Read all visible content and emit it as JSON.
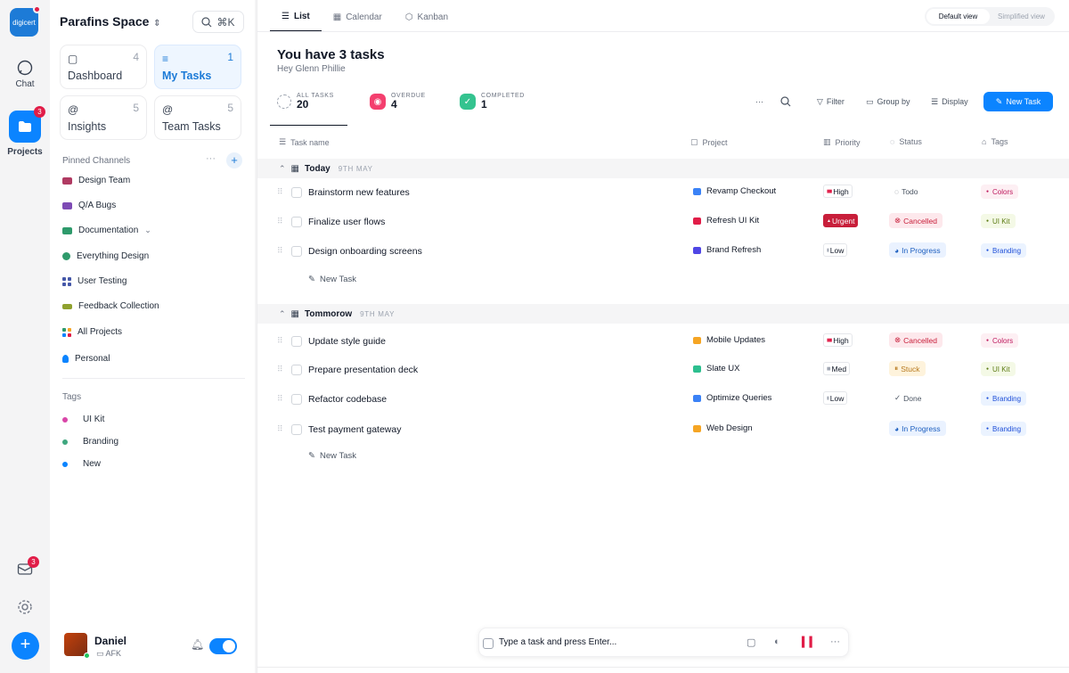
{
  "rail": {
    "logo_text": "digicert",
    "chat_label": "Chat",
    "projects_label": "Projects",
    "projects_badge": "3",
    "inbox_badge": "3"
  },
  "sidebar": {
    "space_name": "Parafins Space",
    "search_shortcut": "⌘K",
    "cards": [
      {
        "label": "Dashboard",
        "count": "4",
        "icon": "chat-icon"
      },
      {
        "label": "My Tasks",
        "count": "1",
        "icon": "filter-icon"
      },
      {
        "label": "Insights",
        "count": "5",
        "icon": "at-icon"
      },
      {
        "label": "Team Tasks",
        "count": "5",
        "icon": "at-icon"
      }
    ],
    "pinned_label": "Pinned Channels",
    "channels": [
      {
        "label": "Design Team",
        "color": "#b03a62"
      },
      {
        "label": "Q/A Bugs",
        "color": "#7e4bb5"
      },
      {
        "label": "Documentation",
        "color": "#2e9a6b"
      },
      {
        "label": "Everything Design",
        "color": "#2e9a6b"
      },
      {
        "label": "User Testing",
        "color": "#4457a8"
      },
      {
        "label": "Feedback Collection",
        "color": "#8fa12e"
      },
      {
        "label": "All Projects",
        "color": "#2e9a6b"
      },
      {
        "label": "Personal",
        "color": "#0b84ff"
      }
    ],
    "tags_label": "Tags",
    "tags": [
      {
        "label": "UI Kit",
        "color": "#d946a8"
      },
      {
        "label": "Branding",
        "color": "#3fa77f"
      },
      {
        "label": "New",
        "color": "#0b84ff"
      }
    ],
    "user": {
      "name": "Daniel",
      "status": "AFK"
    }
  },
  "main": {
    "tabs": [
      "List",
      "Calendar",
      "Kanban"
    ],
    "view_default": "Default view",
    "view_simplified": "Simplified view",
    "title": "You have 3 tasks",
    "subtitle": "Hey Glenn Phillie",
    "stats": [
      {
        "label": "ALL TASKS",
        "value": "20"
      },
      {
        "label": "OVERDUE",
        "value": "4"
      },
      {
        "label": "COMPLETED",
        "value": "1"
      }
    ],
    "toolbar": {
      "filter": "Filter",
      "group_by": "Group by",
      "display": "Display",
      "new_task": "New Task"
    },
    "columns": {
      "task": "Task name",
      "project": "Project",
      "priority": "Priority",
      "status": "Status",
      "tags": "Tags"
    },
    "groups": [
      {
        "name": "Today",
        "date": "9TH MAY",
        "tasks": [
          {
            "name": "Brainstorm new features",
            "project": "Revamp Checkout",
            "project_color": "#3b82f6",
            "priority": "High",
            "status": "Todo",
            "tag": "Colors"
          },
          {
            "name": "Finalize user flows",
            "project": "Refresh UI Kit",
            "project_color": "#e11d48",
            "priority": "Urgent",
            "status": "Cancelled",
            "tag": "UI Kit"
          },
          {
            "name": "Design onboarding screens",
            "project": "Brand Refresh",
            "project_color": "#4f46e5",
            "priority": "Low",
            "status": "In Progress",
            "tag": "Branding"
          }
        ]
      },
      {
        "name": "Tommorow",
        "date": "9TH MAY",
        "tasks": [
          {
            "name": "Update style guide",
            "project": "Mobile Updates",
            "project_color": "#f5a524",
            "priority": "High",
            "status": "Cancelled",
            "tag": "Colors"
          },
          {
            "name": "Prepare presentation deck",
            "project": "Slate UX",
            "project_color": "#2dbf8f",
            "priority": "Med",
            "status": "Stuck",
            "tag": "UI Kit"
          },
          {
            "name": "Refactor codebase",
            "project": "Optimize Queries",
            "project_color": "#3b82f6",
            "priority": "Low",
            "status": "Done",
            "tag": "Branding"
          },
          {
            "name": "Test payment gateway",
            "project": "Web Design",
            "project_color": "#f5a524",
            "priority": "",
            "status": "In Progress",
            "tag": "Branding"
          }
        ]
      }
    ],
    "new_task_row": "New Task",
    "composer_placeholder": "Type a task and press Enter..."
  }
}
